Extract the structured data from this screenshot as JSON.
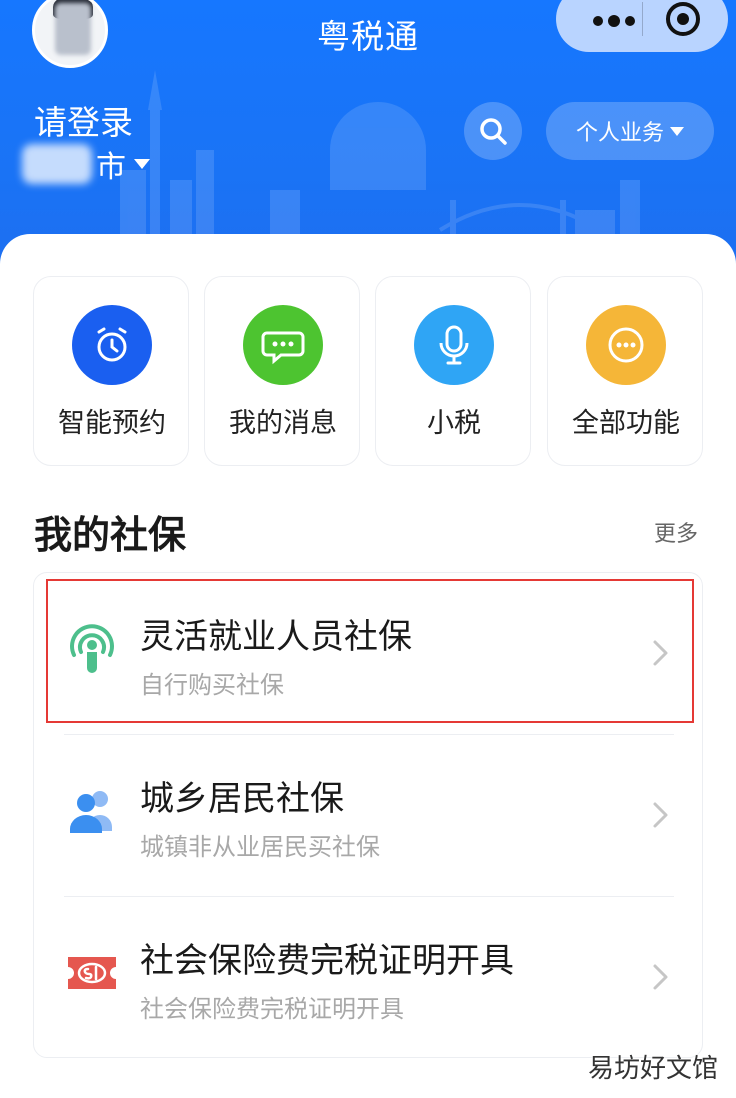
{
  "app": {
    "title": "粤税通"
  },
  "header": {
    "login_label": "请登录",
    "city_suffix": "市",
    "business_label": "个人业务",
    "icons": [
      "search-icon",
      "more-dots-icon",
      "target-icon",
      "caret-down-icon"
    ]
  },
  "quick_actions": [
    {
      "label": "智能预约",
      "icon": "alarm-clock-icon",
      "color": "#1a5ff0"
    },
    {
      "label": "我的消息",
      "icon": "chat-bubble-icon",
      "color": "#4dc430"
    },
    {
      "label": "小税",
      "icon": "microphone-icon",
      "color": "#2fa5f5"
    },
    {
      "label": "全部功能",
      "icon": "more-circle-icon",
      "color": "#f5b638"
    }
  ],
  "social_security": {
    "title": "我的社保",
    "more_label": "更多",
    "items": [
      {
        "title": "灵活就业人员社保",
        "subtitle": "自行购买社保",
        "icon": "broadcast-person-icon",
        "icon_color": "#4dbf8c",
        "highlighted": true
      },
      {
        "title": "城乡居民社保",
        "subtitle": "城镇非从业居民买社保",
        "icon": "people-group-icon",
        "icon_color": "#3b8ff0",
        "highlighted": false
      },
      {
        "title": "社会保险费完税证明开具",
        "subtitle": "社会保险费完税证明开具",
        "icon": "si-ticket-icon",
        "icon_color": "#e5574f",
        "highlighted": false
      }
    ]
  },
  "watermark": "易坊好文馆"
}
